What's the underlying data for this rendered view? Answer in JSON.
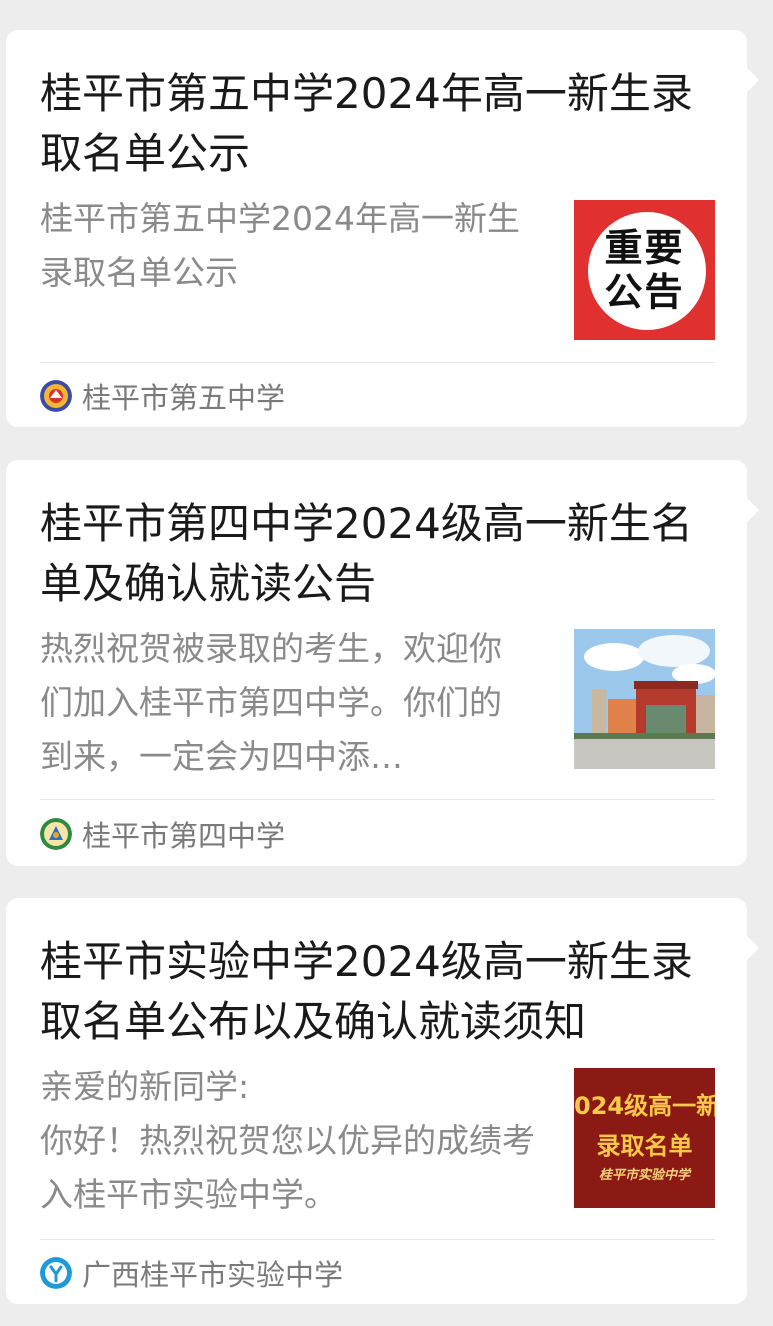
{
  "articles": [
    {
      "title": "桂平市第五中学2024年高一新生录取名单公示",
      "summary": "桂平市第五中学2024年高一新生录取名单公示",
      "thumbnail_text": "重要公告",
      "source": "桂平市第五中学",
      "logo_icon": "school-emblem-icon"
    },
    {
      "title": "桂平市第四中学2024级高一新生名单及确认就读公告",
      "summary": "热烈祝贺被录取的考生，欢迎你们加入桂平市第四中学。你们的到来，一定会为四中添…",
      "source": "桂平市第四中学",
      "logo_icon": "school-emblem-icon"
    },
    {
      "title": "桂平市实验中学2024级高一新生录取名单公布以及确认就读须知",
      "summary": "亲爱的新同学:\n你好！热烈祝贺您以优异的成绩考入桂平市实验中学。",
      "thumbnail_line1": "024级高一新",
      "thumbnail_line2": "录取名单",
      "thumbnail_line3": "桂平市实验中学",
      "source": "广西桂平市实验中学",
      "logo_icon": "school-emblem-icon"
    }
  ],
  "colors": {
    "background": "#ededed",
    "card": "#ffffff",
    "title_text": "#1a1a1a",
    "summary_text": "#8a8a8a",
    "notice_red": "#e03030",
    "banner_red": "#8c1a14"
  }
}
